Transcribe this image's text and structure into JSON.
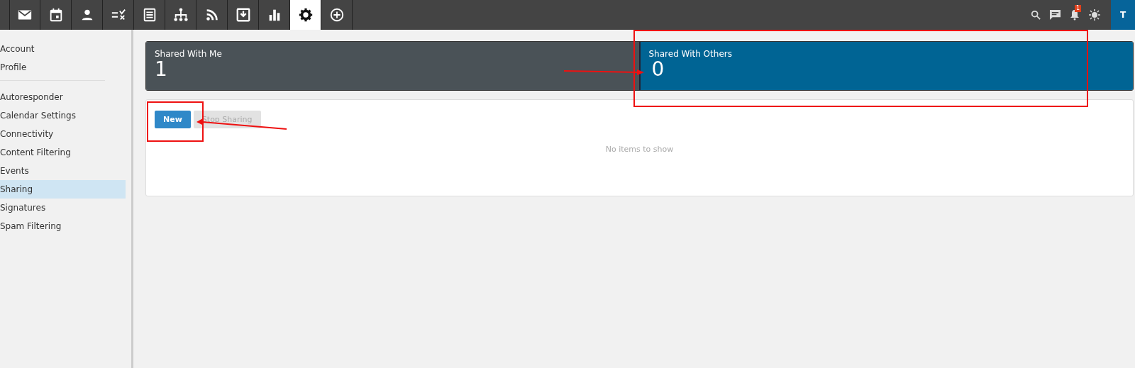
{
  "nav_tabs": [
    {
      "kind": "mail",
      "selected": false
    },
    {
      "kind": "calendar",
      "selected": false
    },
    {
      "kind": "contacts",
      "selected": false
    },
    {
      "kind": "tasks",
      "selected": false
    },
    {
      "kind": "notes",
      "selected": false
    },
    {
      "kind": "tree",
      "selected": false
    },
    {
      "kind": "rss",
      "selected": false
    },
    {
      "kind": "inbox",
      "selected": false
    },
    {
      "kind": "chart",
      "selected": false
    },
    {
      "kind": "settings",
      "selected": true
    },
    {
      "kind": "add",
      "selected": false
    }
  ],
  "top_right": {
    "notification_count": "1",
    "avatar": "T"
  },
  "sidebar": {
    "groups": [
      [
        {
          "label": "Account",
          "selected": false
        },
        {
          "label": "Profile",
          "selected": false
        }
      ],
      [
        {
          "label": "Autoresponder",
          "selected": false
        },
        {
          "label": "Calendar Settings",
          "selected": false
        },
        {
          "label": "Connectivity",
          "selected": false
        },
        {
          "label": "Content Filtering",
          "selected": false
        },
        {
          "label": "Events",
          "selected": false
        },
        {
          "label": "Sharing",
          "selected": true
        },
        {
          "label": "Signatures",
          "selected": false
        },
        {
          "label": "Spam Filtering",
          "selected": false
        }
      ]
    ]
  },
  "stats": [
    {
      "label": "Shared With Me",
      "value": "1",
      "selected": false
    },
    {
      "label": "Shared With Others",
      "value": "0",
      "selected": true
    }
  ],
  "toolbar": [
    {
      "label": "New",
      "disabled": false
    },
    {
      "label": "Stop Sharing",
      "disabled": true
    }
  ],
  "empty_message": "No items to show"
}
